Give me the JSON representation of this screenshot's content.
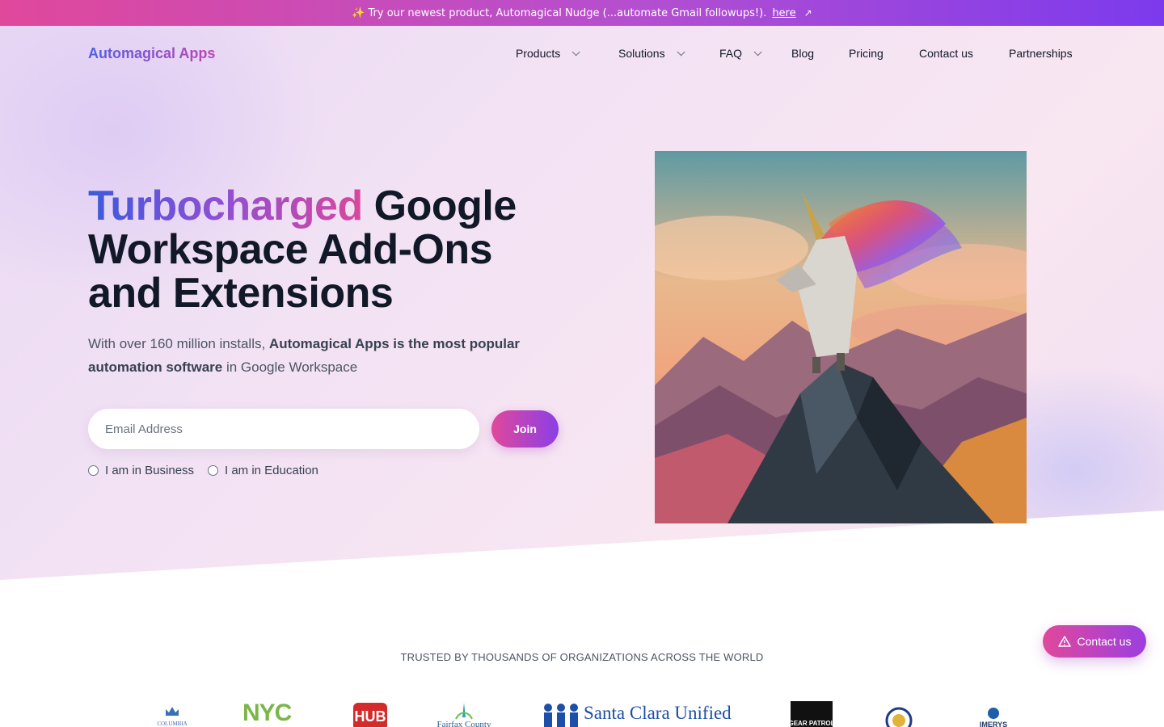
{
  "announcement": {
    "emoji": "✨",
    "text": "Try our newest product, Automagical Nudge (...automate Gmail followups!).",
    "link_label": "here",
    "link_icon": "external-arrow-icon"
  },
  "brand": {
    "name": "Automagical Apps"
  },
  "nav": {
    "items": [
      {
        "label": "Products",
        "dropdown": true
      },
      {
        "label": "Solutions",
        "dropdown": true
      },
      {
        "label": "FAQ",
        "dropdown": true
      },
      {
        "label": "Blog",
        "dropdown": false
      },
      {
        "label": "Pricing",
        "dropdown": false
      },
      {
        "label": "Contact us",
        "dropdown": false
      },
      {
        "label": "Partnerships",
        "dropdown": false
      }
    ]
  },
  "hero": {
    "headline_highlight": "Turbocharged",
    "headline_rest": " Google Workspace Add-Ons and Extensions",
    "sub_prefix": "With over 160 million installs, ",
    "sub_bold": "Automagical Apps is the most popular automation software",
    "sub_suffix": " in Google Workspace",
    "email_placeholder": "Email Address",
    "join_label": "Join",
    "radio_business": "I am in Business",
    "radio_education": "I am in Education"
  },
  "trusted": {
    "heading": "TRUSTED BY THOUSANDS OF ORGANIZATIONS ACROSS THE WORLD",
    "logos": {
      "columbia": "COLUMBIA",
      "nyc": "NYC",
      "hub": "HUB",
      "fairfax": "Fairfax County",
      "santa_clara": "Santa Clara Unified",
      "gear_patrol": "GEAR PATROL",
      "imerys": "IMERYS"
    }
  },
  "fab": {
    "label": "Contact us",
    "icon": "warning-triangle-icon"
  },
  "colors": {
    "accent_pink": "#e0489b",
    "accent_purple": "#7c3aed",
    "accent_blue": "#3b5bdb",
    "text_dark": "#111827"
  }
}
